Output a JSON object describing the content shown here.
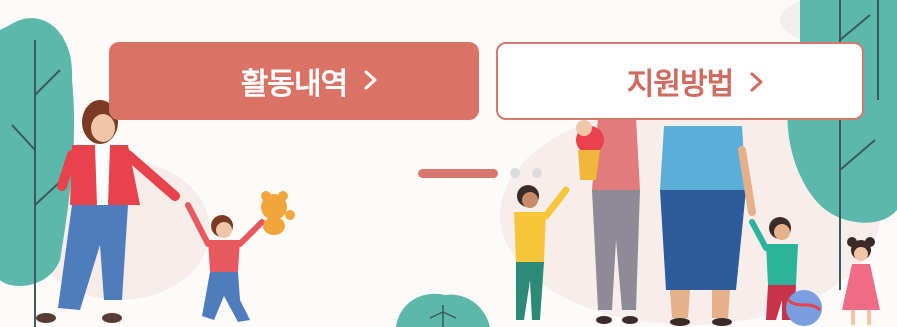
{
  "buttons": {
    "activity_label": "활동내역",
    "support_label": "지원방법"
  },
  "icons": {
    "chevron": "chevron-right-icon"
  },
  "pagination": {
    "total": 3,
    "active_index": 0
  },
  "colors": {
    "primary": "#da7266",
    "primary_text": "#ffffff",
    "secondary_border": "#d8776c",
    "secondary_text": "#cf6b5f",
    "tree": "#5bb8ab",
    "inactive_dot": "#dcdcdc"
  }
}
